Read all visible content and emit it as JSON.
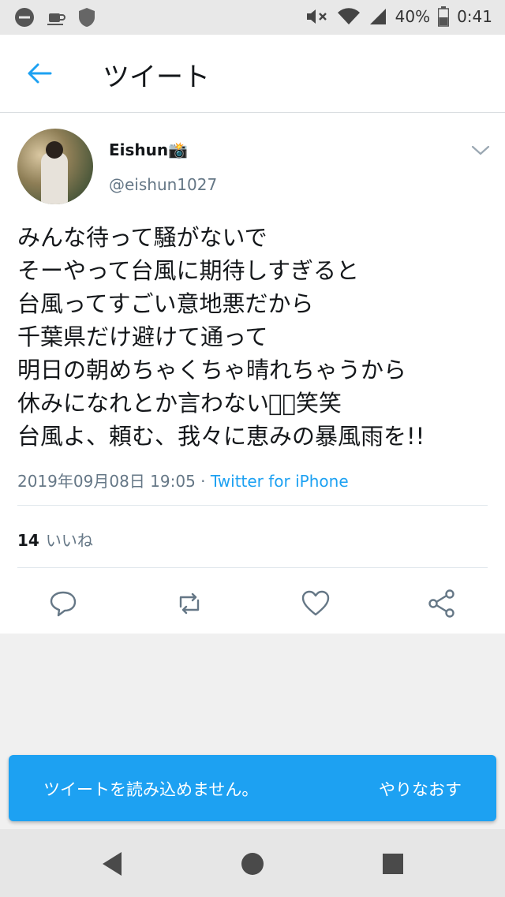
{
  "status_bar": {
    "battery": "40%",
    "time": "0:41",
    "icons": [
      "minus-circle-icon",
      "coffee-icon",
      "shield-icon",
      "mute-icon",
      "wifi-icon",
      "signal-icon",
      "battery-icon"
    ]
  },
  "header": {
    "title": "ツイート",
    "back_icon": "arrow-left-icon"
  },
  "tweet": {
    "display_name": "Eishun📸",
    "handle": "@eishun1027",
    "lines": [
      "みんな待って騒がないで",
      "そーやって台風に期待しすぎると",
      "台風ってすごい意地悪だから",
      "千葉県だけ避けて通って",
      "明日の朝めちゃくちゃ晴れちゃうから",
      "休みになれとか言わないで⃣笑笑",
      "台風よ、頼む、我々に恵みの暴風雨を!!"
    ],
    "timestamp": "2019年09月08日 19:05",
    "separator": " · ",
    "source": "Twitter for iPhone",
    "likes_count": "14",
    "likes_label": "いいね",
    "action_icons": [
      "reply-icon",
      "retweet-icon",
      "like-icon",
      "share-icon"
    ]
  },
  "toast": {
    "message": "ツイートを読み込めません。",
    "action": "やりなおす"
  },
  "nav": {
    "icons": [
      "back-triangle-icon",
      "home-circle-icon",
      "recents-square-icon"
    ]
  },
  "colors": {
    "accent": "#1da1f2",
    "secondary_text": "#657786",
    "primary_text": "#14171a"
  }
}
